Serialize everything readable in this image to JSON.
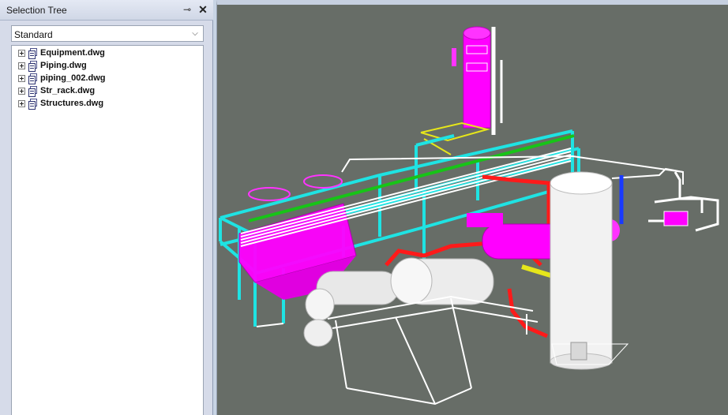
{
  "panel": {
    "title": "Selection Tree",
    "pin_icon": "pin-icon",
    "close_icon": "close-icon",
    "close_glyph": "✕",
    "pin_glyph": "⊸"
  },
  "selection": {
    "value": "Standard",
    "chevron_glyph": "⌵"
  },
  "tree": {
    "items": [
      {
        "label": "Equipment.dwg"
      },
      {
        "label": "Piping.dwg"
      },
      {
        "label": "piping_002.dwg"
      },
      {
        "label": "Str_rack.dwg"
      },
      {
        "label": "Structures.dwg"
      }
    ]
  },
  "viewport": {
    "background": "#676d67",
    "colors": {
      "structure": "#1fe3e3",
      "equipment": "#ff00ff",
      "piping": "#ffffff",
      "hot_piping": "#ff1a1a",
      "walkway": "#e6e61a",
      "beam_top": "#17c417",
      "blue_pipe": "#1a3aff"
    }
  }
}
